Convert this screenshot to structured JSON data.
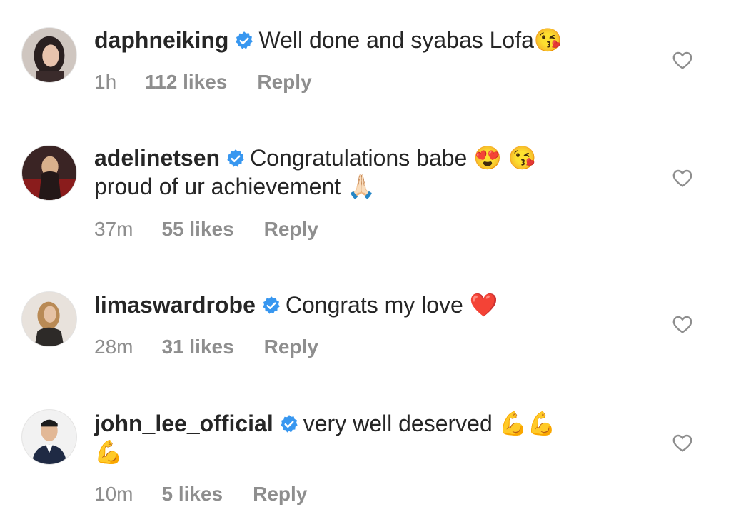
{
  "comments": [
    {
      "username": "daphneiking",
      "text": "Well done and syabas Lofa",
      "emojis": "😘",
      "time": "1h",
      "likes": "112 likes",
      "reply": "Reply"
    },
    {
      "username": "adelinetsen",
      "text": "Congratulations babe",
      "emojis": "😍 😘",
      "text2": "proud of ur achievement",
      "emojis2": "🙏🏻",
      "time": "37m",
      "likes": "55 likes",
      "reply": "Reply"
    },
    {
      "username": "limaswardrobe",
      "text": "Congrats my love",
      "emojis": "❤️",
      "time": "28m",
      "likes": "31 likes",
      "reply": "Reply"
    },
    {
      "username": "john_lee_official",
      "text": "very well deserved",
      "emojis": "💪💪",
      "emojis2": "💪",
      "time": "10m",
      "likes": "5 likes",
      "reply": "Reply"
    }
  ],
  "icons": {
    "verified": "verified-badge-icon",
    "like": "heart-outline-icon"
  },
  "colors": {
    "text": "#262626",
    "meta": "#8e8e8e",
    "verified": "#3897f0"
  }
}
